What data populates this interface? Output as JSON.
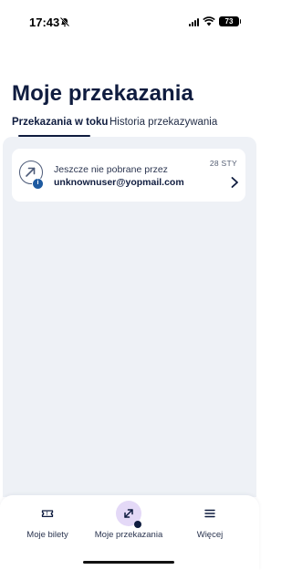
{
  "status_bar": {
    "time": "17:43",
    "battery": "73"
  },
  "page": {
    "title": "Moje przekazania"
  },
  "tabs": [
    {
      "label": "Przekazania w toku",
      "active": true
    },
    {
      "label": "Historia przekazywania",
      "active": false
    }
  ],
  "transfer_card": {
    "title": "Jeszcze nie pobrane przez",
    "email": "unknownuser@yopmail.com",
    "date": "28 STY",
    "badge": "i"
  },
  "bottom_nav": [
    {
      "label": "Moje bilety",
      "icon": "ticket-icon",
      "active": false
    },
    {
      "label": "Moje przekazania",
      "icon": "transfer-arrows-icon",
      "active": true
    },
    {
      "label": "Więcej",
      "icon": "menu-icon",
      "active": false
    }
  ],
  "colors": {
    "primary": "#0f1c3f",
    "content_bg": "#eef1f6",
    "active_bubble": "#e4d9f7",
    "badge": "#1e5aa0"
  }
}
